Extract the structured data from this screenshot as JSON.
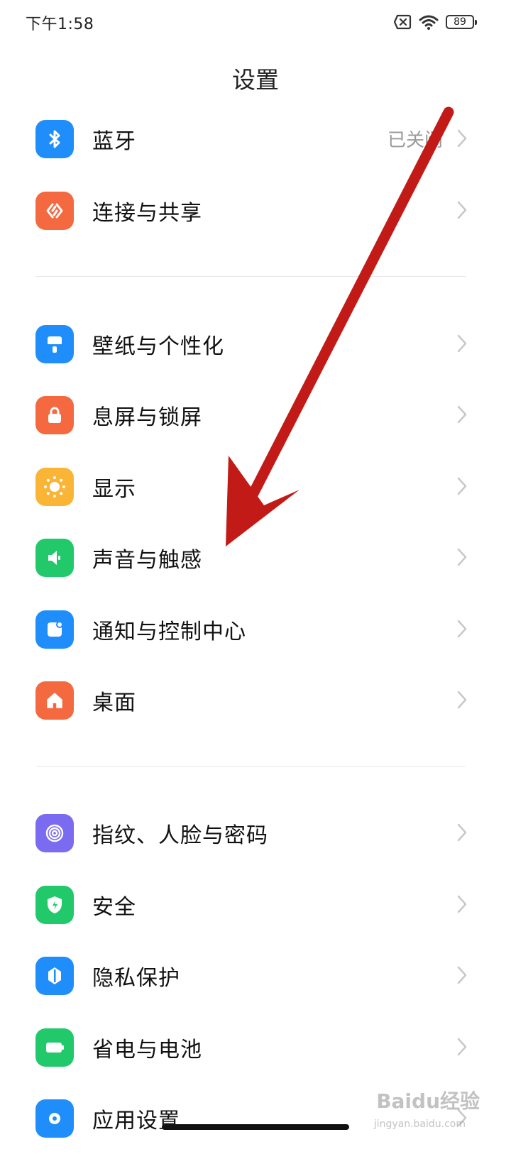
{
  "status_bar": {
    "time": "下午1:58",
    "battery": "89"
  },
  "page": {
    "title": "设置"
  },
  "rows": [
    {
      "label": "蓝牙",
      "value": "已关闭",
      "icon": "bluetooth-icon",
      "color": "#1f8efa"
    },
    {
      "label": "连接与共享",
      "icon": "share-icon",
      "color": "#f4693f"
    },
    {
      "label": "壁纸与个性化",
      "icon": "wallpaper-icon",
      "color": "#1f8efa"
    },
    {
      "label": "息屏与锁屏",
      "icon": "lock-icon",
      "color": "#f4693f"
    },
    {
      "label": "显示",
      "icon": "sun-icon",
      "color": "#fbb536"
    },
    {
      "label": "声音与触感",
      "icon": "speaker-icon",
      "color": "#21c96b"
    },
    {
      "label": "通知与控制中心",
      "icon": "notification-icon",
      "color": "#1f8efa"
    },
    {
      "label": "桌面",
      "icon": "home-icon",
      "color": "#f4693f"
    },
    {
      "label": "指纹、人脸与密码",
      "icon": "fingerprint-icon",
      "color": "#7b6bf0"
    },
    {
      "label": "安全",
      "icon": "shield-icon",
      "color": "#21c96b"
    },
    {
      "label": "隐私保护",
      "icon": "privacy-icon",
      "color": "#1f8efa"
    },
    {
      "label": "省电与电池",
      "icon": "battery-saver-icon",
      "color": "#21c96b"
    },
    {
      "label": "应用设置",
      "icon": "apps-icon",
      "color": "#1f8efa"
    }
  ],
  "watermark": {
    "text": "Baidu经验",
    "subtext": "jingyan.baidu.com"
  },
  "annotation": {
    "arrow_color": "#c21b17"
  }
}
